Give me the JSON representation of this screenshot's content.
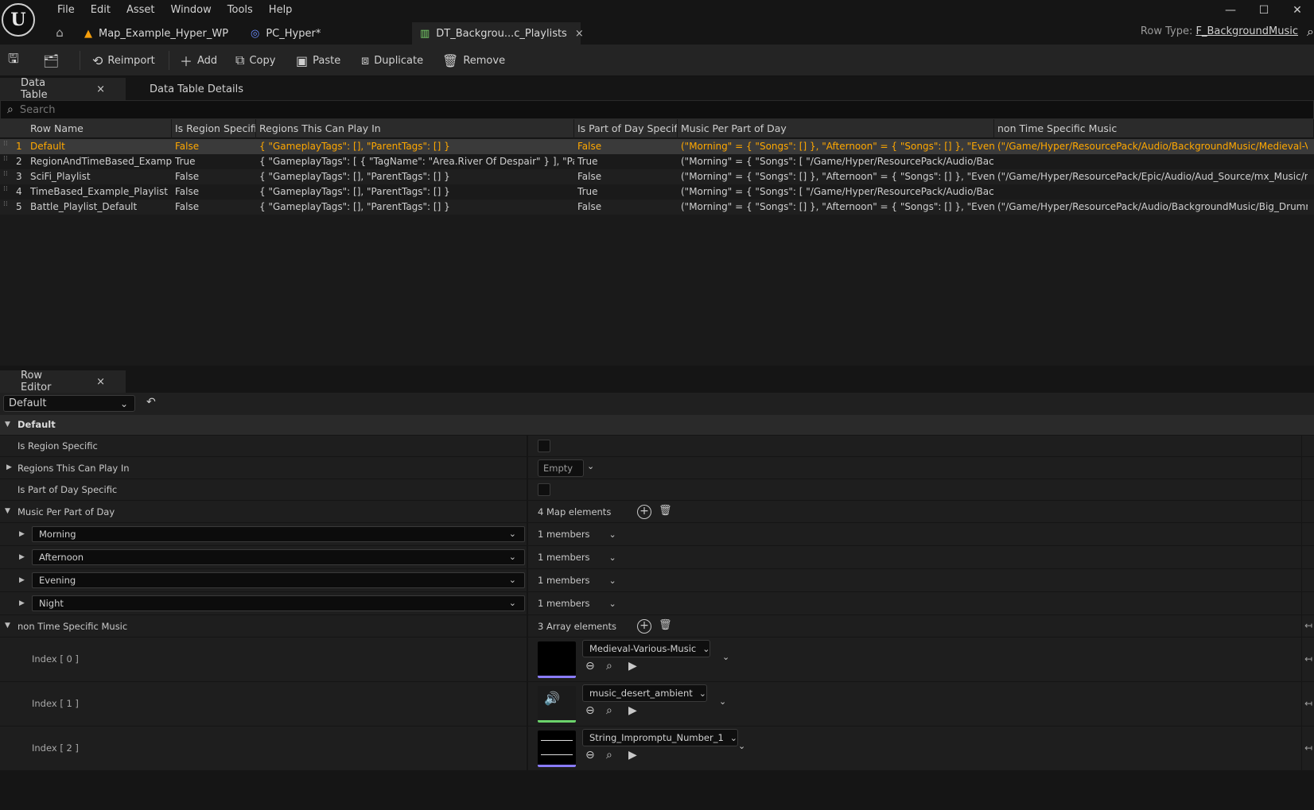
{
  "menu": [
    "File",
    "Edit",
    "Asset",
    "Window",
    "Tools",
    "Help"
  ],
  "window_controls": [
    "—",
    "☐",
    "✕"
  ],
  "doc_tabs": [
    {
      "label": "Map_Example_Hyper_WP",
      "icon": "level-icon",
      "color": "#f59e0b"
    },
    {
      "label": "PC_Hyper*",
      "icon": "controller-icon",
      "color": "#6b8cff"
    },
    {
      "label": "DT_Backgrou...c_Playlists",
      "icon": "datatable-icon",
      "color": "#7ad36b",
      "close": "×"
    }
  ],
  "row_type": {
    "label": "Row Type:",
    "value": "F_BackgroundMusic"
  },
  "toolbar": {
    "reimport": "Reimport",
    "add": "Add",
    "copy": "Copy",
    "paste": "Paste",
    "duplicate": "Duplicate",
    "remove": "Remove"
  },
  "panel_tabs": {
    "data_table": "Data Table",
    "details": "Data Table Details",
    "close": "×"
  },
  "search": {
    "placeholder": "Search"
  },
  "table": {
    "columns": [
      "Row Name",
      "Is Region Specific",
      "Regions This Can Play In",
      "Is Part of Day Specific",
      "Music Per Part of Day",
      "non Time Specific Music"
    ],
    "rows": [
      {
        "num": "1",
        "name": "Default",
        "region": "False",
        "regions": "{ \"GameplayTags\": [], \"ParentTags\": [] }",
        "partday": "False",
        "music": "(\"Morning\" = { \"Songs\": [] }, \"Afternoon\" = { \"Songs\": [] }, \"Evening\" = { \"Songs\": [] }",
        "nontime": "(\"/Game/Hyper/ResourcePack/Audio/BackgroundMusic/Medieval-Various-Music"
      },
      {
        "num": "2",
        "name": "RegionAndTimeBased_Example",
        "region": "True",
        "regions": "{ \"GameplayTags\": [ { \"TagName\": \"Area.River Of Despair\" } ], \"ParentTags\": [] }",
        "partday": "True",
        "music": "(\"Morning\" = { \"Songs\": [ \"/Game/Hyper/ResourcePack/Audio/BackgroundMusic",
        "nontime": ""
      },
      {
        "num": "3",
        "name": "SciFi_Playlist",
        "region": "False",
        "regions": "{ \"GameplayTags\": [], \"ParentTags\": [] }",
        "partday": "False",
        "music": "(\"Morning\" = { \"Songs\": [] }, \"Afternoon\" = { \"Songs\": [] }, \"Evening\" = { \"Songs\": [] }",
        "nontime": "(\"/Game/Hyper/ResourcePack/Epic/Audio/Aud_Source/mx_Music/mx_int"
      },
      {
        "num": "4",
        "name": "TimeBased_Example_Playlist",
        "region": "False",
        "regions": "{ \"GameplayTags\": [], \"ParentTags\": [] }",
        "partday": "True",
        "music": "(\"Morning\" = { \"Songs\": [ \"/Game/Hyper/ResourcePack/Audio/BackgroundMusic",
        "nontime": ""
      },
      {
        "num": "5",
        "name": "Battle_Playlist_Default",
        "region": "False",
        "regions": "{ \"GameplayTags\": [], \"ParentTags\": [] }",
        "partday": "False",
        "music": "(\"Morning\" = { \"Songs\": [] }, \"Afternoon\" = { \"Songs\": [] }, \"Evening\" = { \"Songs\": [] }",
        "nontime": "(\"/Game/Hyper/ResourcePack/Audio/BackgroundMusic/Big_Drumming.Big"
      }
    ]
  },
  "row_editor": {
    "tab": "Row Editor",
    "selected_row": "Default",
    "section": "Default",
    "props": {
      "is_region_specific": "Is Region Specific",
      "regions": "Regions This Can Play In",
      "regions_value": "Empty",
      "is_part_of_day": "Is Part of Day Specific",
      "music_per_part": "Music Per Part of Day",
      "map_elements": "4 Map elements",
      "non_time": "non Time Specific Music",
      "array_elements": "3 Array elements"
    },
    "map_entries": [
      {
        "key": "Morning",
        "members": "1 members"
      },
      {
        "key": "Afternoon",
        "members": "1 members"
      },
      {
        "key": "Evening",
        "members": "1 members"
      },
      {
        "key": "Night",
        "members": "1 members"
      }
    ],
    "array_entries": [
      {
        "index": "Index [ 0 ]",
        "asset": "Medieval-Various-Music"
      },
      {
        "index": "Index [ 1 ]",
        "asset": "music_desert_ambient"
      },
      {
        "index": "Index [ 2 ]",
        "asset": "String_Impromptu_Number_1"
      }
    ]
  }
}
